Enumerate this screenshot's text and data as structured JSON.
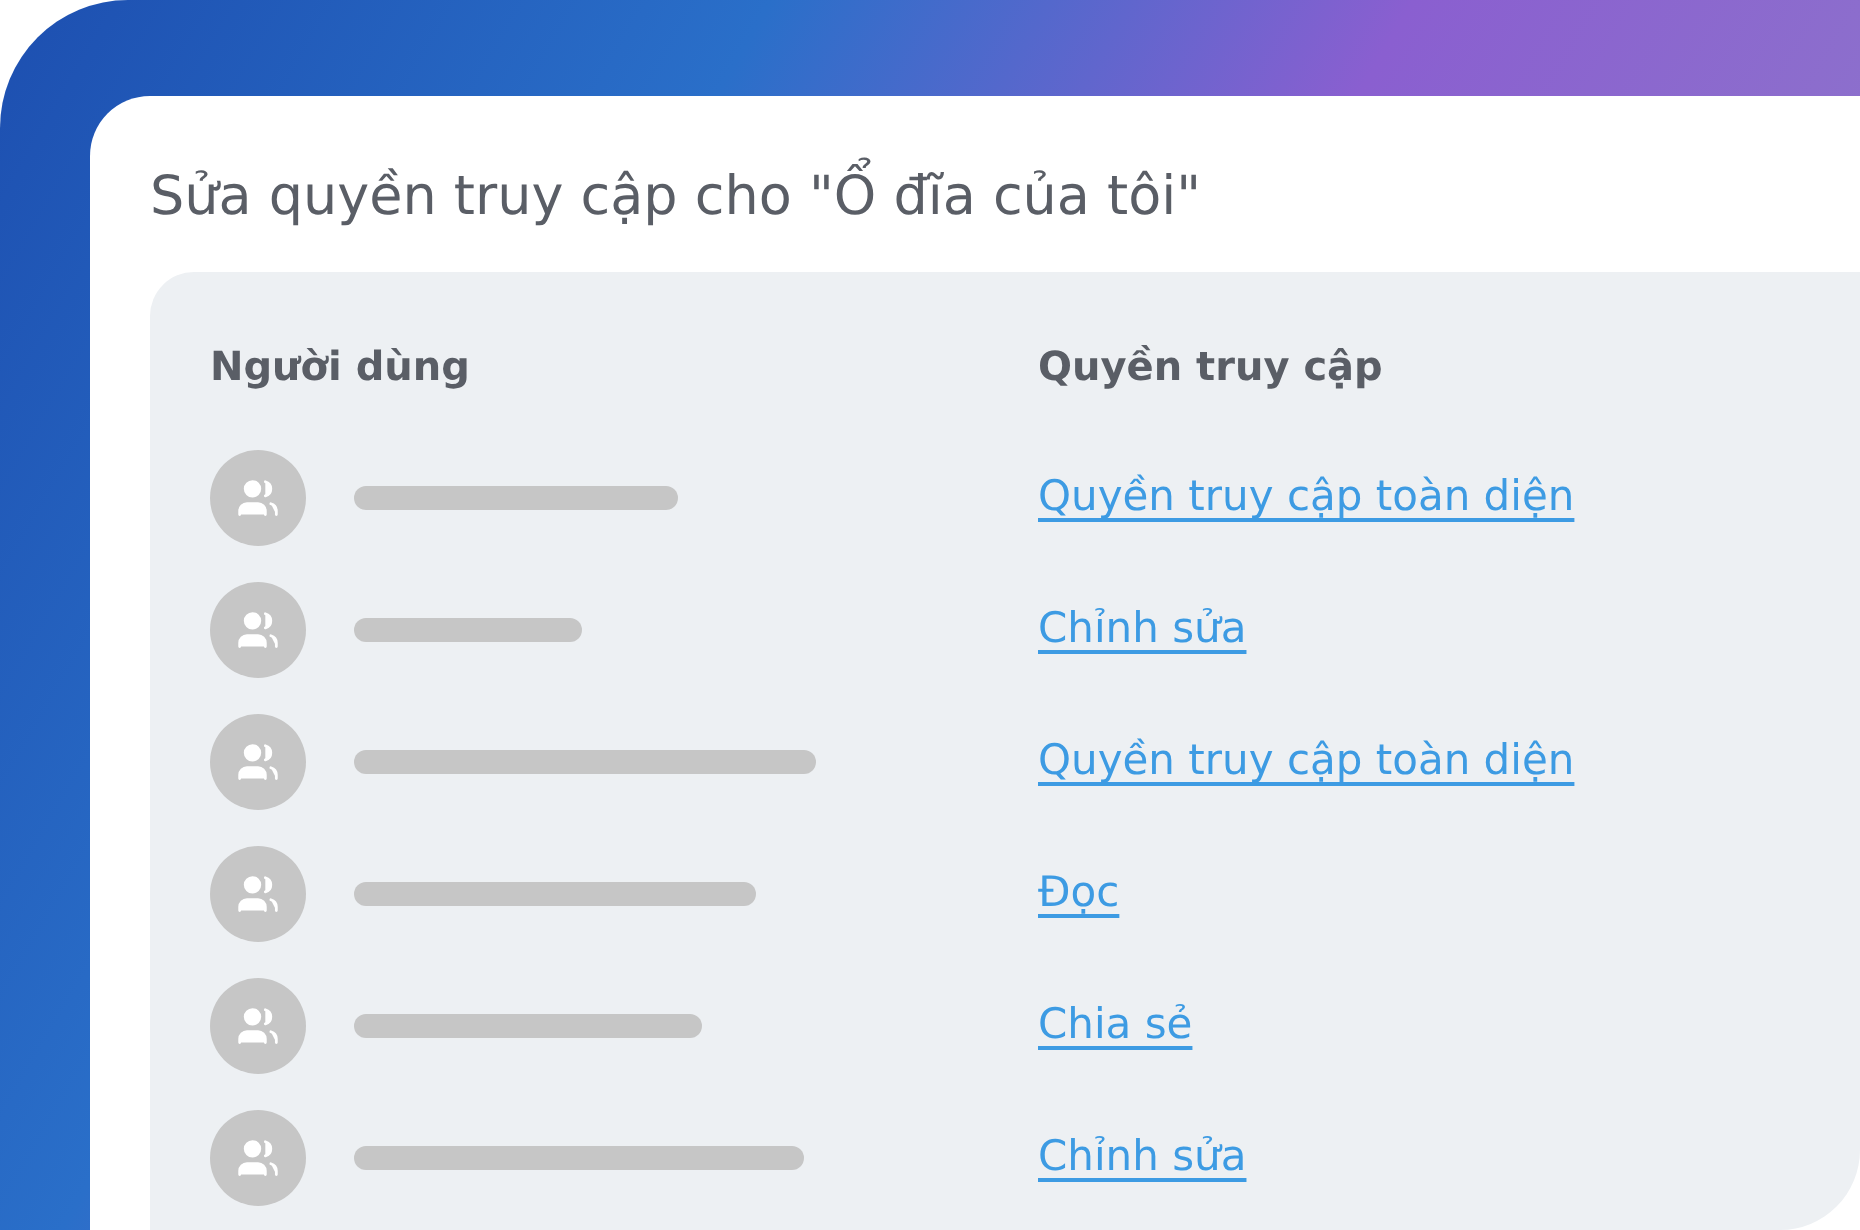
{
  "dialog": {
    "title": "Sửa quyền truy cập cho \"Ổ đĩa của tôi\""
  },
  "table": {
    "columns": [
      "Người dùng",
      "Quyền truy cập"
    ],
    "rows": [
      {
        "access": "Quyền truy cập toàn diện"
      },
      {
        "access": "Chỉnh sửa"
      },
      {
        "access": "Quyền truy cập toàn diện"
      },
      {
        "access": "Đọc"
      },
      {
        "access": "Chia sẻ"
      },
      {
        "access": "Chỉnh sửa"
      }
    ]
  }
}
